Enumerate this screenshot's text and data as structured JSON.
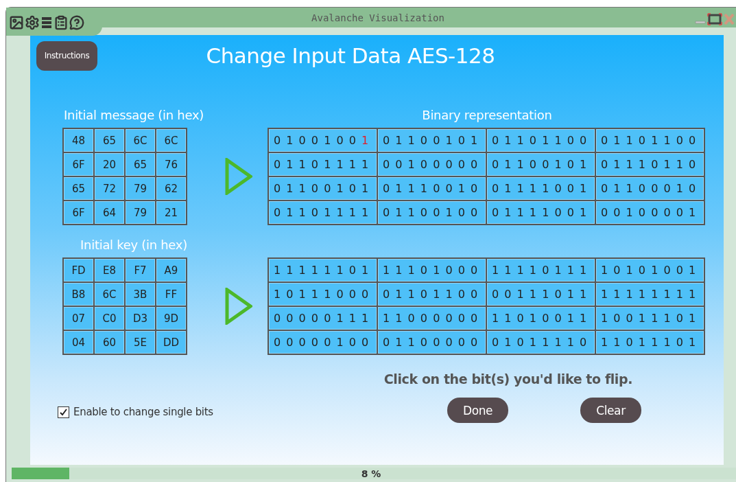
{
  "window": {
    "title": "Avalanche Visualization"
  },
  "instructions_button": "Instructions",
  "page_title": "Change Input Data AES-128",
  "message": {
    "label": "Initial message (in hex)",
    "hex": [
      [
        "48",
        "65",
        "6C",
        "6C"
      ],
      [
        "6F",
        "20",
        "65",
        "76"
      ],
      [
        "65",
        "72",
        "79",
        "62"
      ],
      [
        "6F",
        "64",
        "79",
        "21"
      ]
    ],
    "binary_label": "Binary representation",
    "binary": [
      [
        {
          "bits": "0 1 0 0 1 0 0 1",
          "flipped": [
            false,
            false,
            false,
            false,
            false,
            false,
            false,
            true
          ]
        },
        {
          "bits": "0 1 1 0 0 1 0 1"
        },
        {
          "bits": "0 1 1 0 1 1 0 0"
        },
        {
          "bits": "0 1 1 0 1 1 0 0"
        }
      ],
      [
        {
          "bits": "0 1 1 0 1 1 1 1"
        },
        {
          "bits": "0 0 1 0 0 0 0 0"
        },
        {
          "bits": "0 1 1 0 0 1 0 1"
        },
        {
          "bits": "0 1 1 1 0 1 1 0"
        }
      ],
      [
        {
          "bits": "0 1 1 0 0 1 0 1"
        },
        {
          "bits": "0 1 1 1 0 0 1 0"
        },
        {
          "bits": "0 1 1 1 1 0 0 1"
        },
        {
          "bits": "0 1 1 0 0 0 1 0"
        }
      ],
      [
        {
          "bits": "0 1 1 0 1 1 1 1"
        },
        {
          "bits": "0 1 1 0 0 1 0 0"
        },
        {
          "bits": "0 1 1 1 1 0 0 1"
        },
        {
          "bits": "0 0 1 0 0 0 0 1"
        }
      ]
    ]
  },
  "key": {
    "label": "Initial key (in hex)",
    "hex": [
      [
        "FD",
        "E8",
        "F7",
        "A9"
      ],
      [
        "B8",
        "6C",
        "3B",
        "FF"
      ],
      [
        "07",
        "C0",
        "D3",
        "9D"
      ],
      [
        "04",
        "60",
        "5E",
        "DD"
      ]
    ],
    "binary": [
      [
        {
          "bits": "1 1 1 1 1 1 0 1"
        },
        {
          "bits": "1 1 1 0 1 0 0 0"
        },
        {
          "bits": "1 1 1 1 0 1 1 1"
        },
        {
          "bits": "1 0 1 0 1 0 0 1"
        }
      ],
      [
        {
          "bits": "1 0 1 1 1 0 0 0"
        },
        {
          "bits": "0 1 1 0 1 1 0 0"
        },
        {
          "bits": "0 0 1 1 1 0 1 1"
        },
        {
          "bits": "1 1 1 1 1 1 1 1"
        }
      ],
      [
        {
          "bits": "0 0 0 0 0 1 1 1"
        },
        {
          "bits": "1 1 0 0 0 0 0 0"
        },
        {
          "bits": "1 1 0 1 0 0 1 1"
        },
        {
          "bits": "1 0 0 1 1 1 0 1"
        }
      ],
      [
        {
          "bits": "0 0 0 0 0 1 0 0"
        },
        {
          "bits": "0 1 1 0 0 0 0 0"
        },
        {
          "bits": "0 1 0 1 1 1 1 0"
        },
        {
          "bits": "1 1 0 1 1 1 0 1"
        }
      ]
    ]
  },
  "single_bits_checkbox": {
    "label": "Enable to change single bits",
    "checked": true
  },
  "hint": "Click on the bit(s) you'd like to flip.",
  "buttons": [
    "Done",
    "Clear"
  ],
  "status_bar": {
    "level": 0.08,
    "reading": "8 %"
  }
}
